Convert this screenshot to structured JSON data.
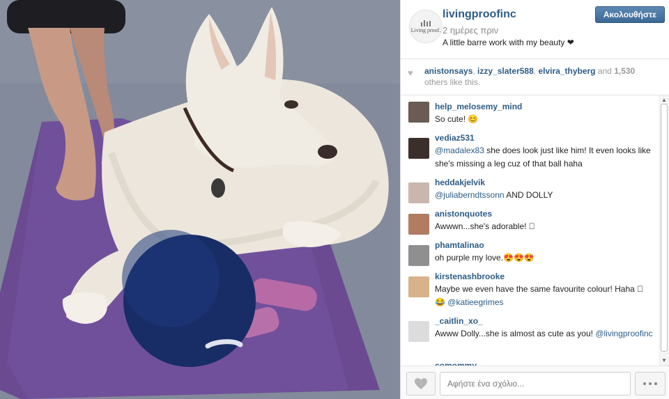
{
  "post": {
    "username": "livingproofinc",
    "time": "2 ημέρες πριν",
    "caption": "A little barre work with my beauty ❤",
    "follow_label": "Ακολουθήστε",
    "avatar_logo_text": "Living proof."
  },
  "likes": {
    "likers": [
      "anistonsays",
      "izzy_slater588",
      "elvira_thyberg"
    ],
    "sep1": ", ",
    "sep2": ", ",
    "and_text": " and ",
    "count": "1,530",
    "others_text": "others like this."
  },
  "comments": [
    {
      "user": "help_melosemy_mind",
      "text": "So cute! 😊",
      "avatar_color": "#6a5b55"
    },
    {
      "user": "vediaz531",
      "mention": "@madalex83",
      "text": " she does look just like him! It even looks like she's missing a leg cuz of that ball haha",
      "avatar_color": "#3b2f2c"
    },
    {
      "user": "heddakjelvik",
      "mention": "@juliaberndtssonn",
      "text": " AND DOLLY",
      "avatar_color": "#c9b7ae"
    },
    {
      "user": "anistonquotes",
      "text": "Awwwn...she's adorable! 🏻",
      "avatar_color": "#b07c62"
    },
    {
      "user": "phamtalinao",
      "text": "oh purple my love.😍😍😍",
      "avatar_color": "#8f8f8f"
    },
    {
      "user": "kirstenashbrooke",
      "text": "Maybe we even have the same favourite colour! Haha 🏻😂 ",
      "mention_after": "@katieegrimes",
      "avatar_color": "#d8b28a"
    },
    {
      "user": "_caitlin_xo_",
      "text": "Awww Dolly...she is almost as cute as you! ",
      "mention_after": "@livingproofinc",
      "avatar_color": "#dcdcdc"
    },
    {
      "user": "comommy",
      "text": "",
      "avatar_color": "#c8d4de"
    }
  ],
  "footer": {
    "comment_placeholder": "Αφήστε ένα σχόλιο..."
  },
  "icons": {
    "heart": "heart-icon",
    "more": "more-dots-icon"
  },
  "colors": {
    "link": "#2d5c86",
    "follow_button": "#4a76a2"
  }
}
